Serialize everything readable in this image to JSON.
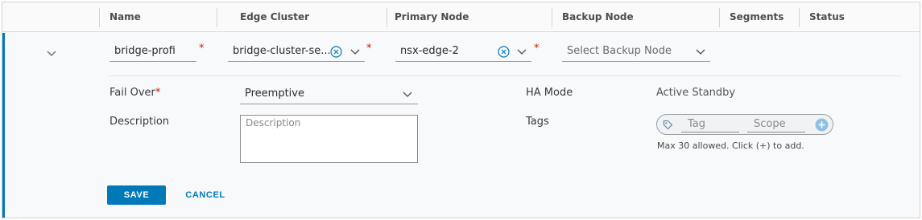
{
  "columns": {
    "name": "Name",
    "edge_cluster": "Edge Cluster",
    "primary_node": "Primary Node",
    "backup_node": "Backup Node",
    "segments": "Segments",
    "status": "Status"
  },
  "row": {
    "name_value": "bridge-profi",
    "required_mark": "*",
    "edge_cluster_value": "bridge-cluster-se...",
    "primary_node_value": "nsx-edge-2",
    "backup_node_placeholder": "Select Backup Node"
  },
  "details": {
    "fail_over_label": "Fail Over",
    "fail_over_value": "Preemptive",
    "description_label": "Description",
    "description_placeholder": "Description",
    "ha_mode_label": "HA Mode",
    "ha_mode_value": "Active Standby",
    "tags_label": "Tags",
    "tag_placeholder": "Tag",
    "scope_placeholder": "Scope",
    "tags_hint": "Max 30 allowed. Click (+) to add."
  },
  "actions": {
    "save_label": "SAVE",
    "cancel_label": "CANCEL"
  },
  "colors": {
    "accent": "#0079b8",
    "required": "#c92100"
  },
  "icons": [
    "chevron-down-icon",
    "clear-circle-icon",
    "tag-icon",
    "plus-circle-icon"
  ]
}
